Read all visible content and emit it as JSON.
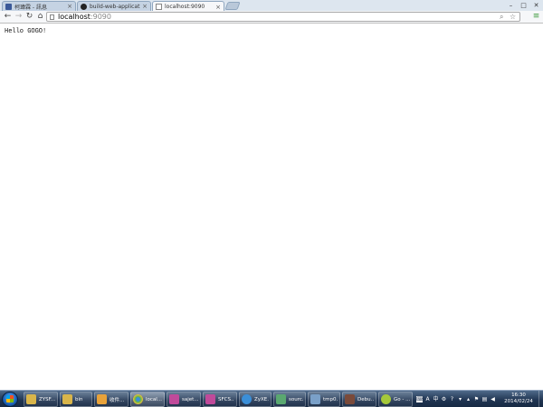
{
  "browser": {
    "tabs": [
      {
        "title": "柯瑋霖 - 訊息",
        "icon": "facebook-icon",
        "active": false
      },
      {
        "title": "build-web-application",
        "icon": "github-icon",
        "active": false
      },
      {
        "title": "localhost:9090",
        "icon": "page-icon",
        "active": true
      }
    ],
    "window_controls": {
      "minimize": "–",
      "maximize": "□",
      "close": "✕"
    },
    "address": {
      "host": "localhost",
      "port": ":9090"
    }
  },
  "page": {
    "text": "Hello GOGO!"
  },
  "taskbar": {
    "items": [
      {
        "label": "ZYSF...",
        "icon": "folder-icon",
        "color": "#d9b54a"
      },
      {
        "label": "bin",
        "icon": "folder-icon",
        "color": "#d9b54a"
      },
      {
        "label": "收件...",
        "icon": "outlook-icon",
        "color": "#e8a23a"
      },
      {
        "label": "local...",
        "icon": "chrome-icon",
        "color": "#4caf50"
      },
      {
        "label": "sajet...",
        "icon": "app-icon",
        "color": "#c04a9a"
      },
      {
        "label": "SFCS...",
        "icon": "app-icon",
        "color": "#c04a9a"
      },
      {
        "label": "ZyXE...",
        "icon": "ie-icon",
        "color": "#3b8fd8"
      },
      {
        "label": "sourc...",
        "icon": "notepad-icon",
        "color": "#5aa870"
      },
      {
        "label": "tmp0...",
        "icon": "notepad-icon",
        "color": "#7aa0c8"
      },
      {
        "label": "Debu...",
        "icon": "app-icon",
        "color": "#7a4a3a"
      },
      {
        "label": "Go - ...",
        "icon": "go-icon",
        "color": "#a5c83a"
      }
    ],
    "clock": {
      "time": "16:30",
      "date": "2014/02/24"
    }
  },
  "colors": {
    "taskbar": "#1f3350",
    "tab_strip": "#dde6ef"
  }
}
